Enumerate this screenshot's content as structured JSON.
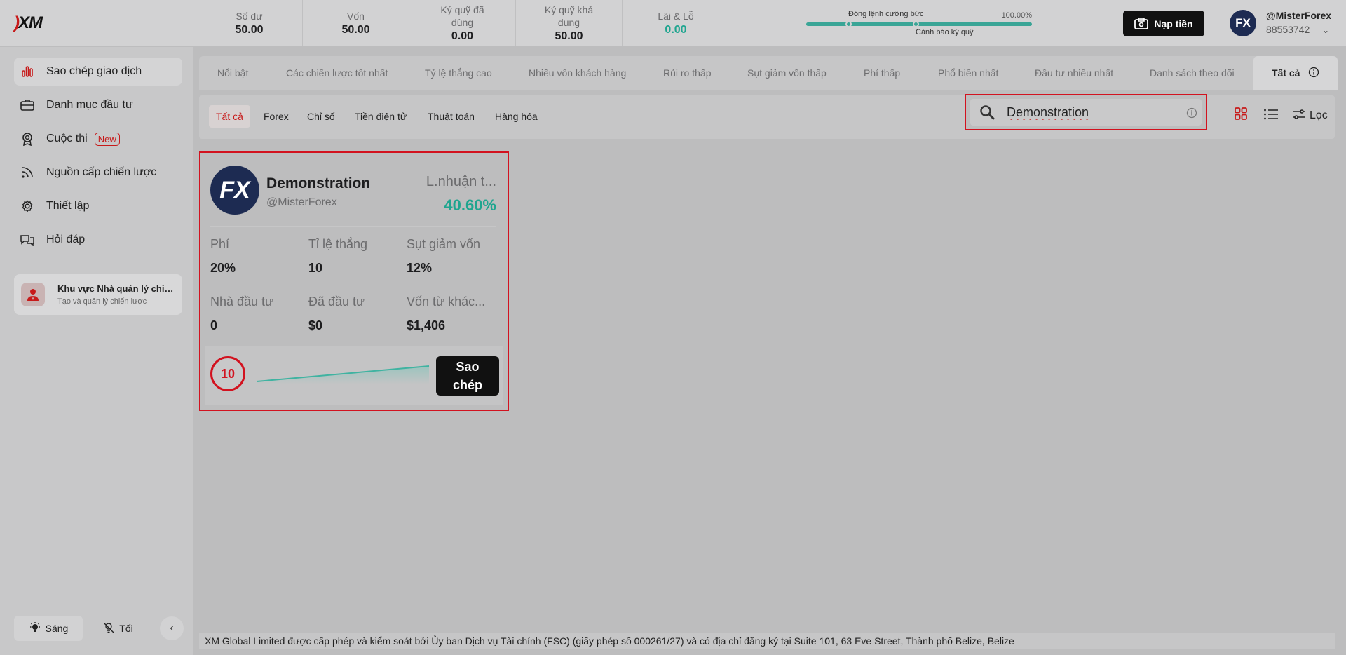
{
  "header": {
    "logo": "XM",
    "stats": [
      {
        "label": "Số dư",
        "value": "50.00"
      },
      {
        "label": "Vốn",
        "value": "50.00"
      },
      {
        "label": "Ký quỹ đã dùng",
        "value": "0.00"
      },
      {
        "label": "Ký quỹ khả dụng",
        "value": "50.00"
      },
      {
        "label": "Lãi & Lỗ",
        "value": "0.00"
      }
    ],
    "margin": {
      "stop_out_label": "Đóng lệnh cưỡng bức",
      "margin_call_label": "Cảnh báo ký quỹ",
      "level": "100.00%"
    },
    "deposit_label": "Nạp tiền",
    "user": {
      "avatar": "FX",
      "name": "@MisterForex",
      "id": "88553742"
    }
  },
  "sidebar": {
    "items": [
      {
        "label": "Sao chép giao dịch"
      },
      {
        "label": "Danh mục đầu tư"
      },
      {
        "label": "Cuộc thi",
        "badge": "New"
      },
      {
        "label": "Nguồn cấp chiến lược"
      },
      {
        "label": "Thiết lập"
      },
      {
        "label": "Hỏi đáp"
      }
    ],
    "manager": {
      "title": "Khu vực Nhà quản lý chiến lược",
      "subtitle": "Tạo và quản lý chiến lược"
    },
    "theme": {
      "light": "Sáng",
      "dark": "Tối"
    }
  },
  "category_tabs": [
    "Nổi bật",
    "Các chiến lược tốt nhất",
    "Tỷ lệ thắng cao",
    "Nhiều vốn khách hàng",
    "Rủi ro thấp",
    "Sụt giảm vốn thấp",
    "Phí thấp",
    "Phổ biến nhất",
    "Đầu tư nhiều nhất",
    "Danh sách theo dõi",
    "Tất cả"
  ],
  "asset_tabs": [
    "Tất cả",
    "Forex",
    "Chỉ số",
    "Tiền điện tử",
    "Thuật toán",
    "Hàng hóa"
  ],
  "search": {
    "value": "Demonstration"
  },
  "filter_label": "Lọc",
  "card": {
    "avatar": "FX",
    "name": "Demonstration",
    "handle": "@MisterForex",
    "profit_label": "L.nhuận t...",
    "profit": "40.60%",
    "metrics": [
      {
        "label": "Phí",
        "value": "20%"
      },
      {
        "label": "Tỉ lệ thắng",
        "value": "10"
      },
      {
        "label": "Sụt giảm vốn",
        "value": "12%"
      },
      {
        "label": "Nhà đầu tư",
        "value": "0"
      },
      {
        "label": "Đã đầu tư",
        "value": "$0"
      },
      {
        "label": "Vốn từ khác...",
        "value": "$1,406"
      }
    ],
    "rank": "10",
    "copy_label_1": "Sao",
    "copy_label_2": "chép"
  },
  "footer": "XM Global Limited được cấp phép và kiểm soát bởi Ủy ban Dịch vụ Tài chính (FSC) (giấy phép số 000261/27) và có địa chỉ đăng ký tại Suite 101, 63 Eve Street, Thành phố Belize, Belize",
  "colors": {
    "accent": "#c71a1a",
    "profit": "#1fa58f",
    "margin_bar": "#3aa596"
  }
}
